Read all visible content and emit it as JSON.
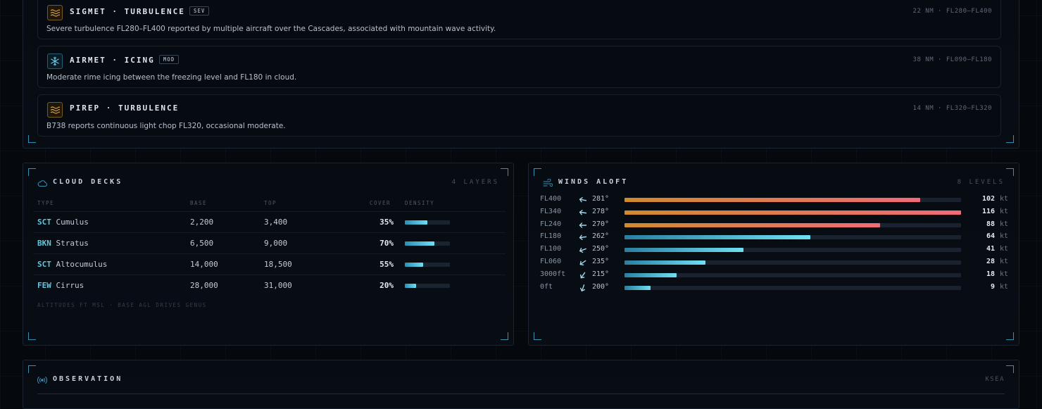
{
  "advisories": [
    {
      "type": "SIGMET",
      "hazard": "TURBULENCE",
      "severity": "SEV",
      "icon": "turbulence-icon",
      "range": "22 NM",
      "levels": "FL280–FL400",
      "description": "Severe turbulence FL280–FL400 reported by multiple aircraft over the Cascades, associated with mountain wave activity."
    },
    {
      "type": "AIRMET",
      "hazard": "ICING",
      "severity": "MOD",
      "icon": "snowflake-icon",
      "range": "38 NM",
      "levels": "FL090–FL180",
      "description": "Moderate rime icing between the freezing level and FL180 in cloud."
    },
    {
      "type": "PIREP",
      "hazard": "TURBULENCE",
      "severity": "",
      "icon": "turbulence-icon",
      "range": "14 NM",
      "levels": "FL320–FL320",
      "description": "B738 reports continuous light chop FL320, occasional moderate."
    }
  ],
  "cloud_decks": {
    "title": "CLOUD DECKS",
    "count_label": "4 LAYERS",
    "columns": [
      "TYPE",
      "BASE",
      "TOP",
      "COVER",
      "DENSITY"
    ],
    "rows": [
      {
        "code": "SCT",
        "genus": "Cumulus",
        "base": "2,200",
        "top": "3,400",
        "cover": "35%",
        "cover_value": 35,
        "density": 0.5
      },
      {
        "code": "BKN",
        "genus": "Stratus",
        "base": "6,500",
        "top": "9,000",
        "cover": "70%",
        "cover_value": 70,
        "density": 0.66
      },
      {
        "code": "SCT",
        "genus": "Altocumulus",
        "base": "14,000",
        "top": "18,500",
        "cover": "55%",
        "cover_value": 55,
        "density": 0.41
      },
      {
        "code": "FEW",
        "genus": "Cirrus",
        "base": "28,000",
        "top": "31,000",
        "cover": "20%",
        "cover_value": 20,
        "density": 0.25
      }
    ],
    "footnote": "ALTITUDES FT MSL · BASE AGL DRIVES GENUS"
  },
  "winds_aloft": {
    "title": "WINDS ALOFT",
    "count_label": "8 LEVELS",
    "unit": "kt",
    "max_speed": 116,
    "levels": [
      {
        "level": "FL400",
        "direction": "281°",
        "dir_deg": 281,
        "speed": "102",
        "speed_value": 102,
        "band": "warm"
      },
      {
        "level": "FL340",
        "direction": "278°",
        "dir_deg": 278,
        "speed": "116",
        "speed_value": 116,
        "band": "warm"
      },
      {
        "level": "FL240",
        "direction": "270°",
        "dir_deg": 270,
        "speed": "88",
        "speed_value": 88,
        "band": "warm"
      },
      {
        "level": "FL180",
        "direction": "262°",
        "dir_deg": 262,
        "speed": "64",
        "speed_value": 64,
        "band": "cool"
      },
      {
        "level": "FL100",
        "direction": "250°",
        "dir_deg": 250,
        "speed": "41",
        "speed_value": 41,
        "band": "cool"
      },
      {
        "level": "FL060",
        "direction": "235°",
        "dir_deg": 235,
        "speed": "28",
        "speed_value": 28,
        "band": "cool"
      },
      {
        "level": "3000ft",
        "direction": "215°",
        "dir_deg": 215,
        "speed": "18",
        "speed_value": 18,
        "band": "cool"
      },
      {
        "level": "0ft",
        "direction": "200°",
        "dir_deg": 200,
        "speed": "9",
        "speed_value": 9,
        "band": "cool"
      }
    ]
  },
  "observation": {
    "title": "OBSERVATION",
    "station": "KSEA"
  },
  "colors": {
    "accent": "#3a8fb5",
    "warm_start": "#d08a2c",
    "warm_end": "#f06a78",
    "cool_start": "#2a7fa0",
    "cool_end": "#6ee0f2"
  }
}
